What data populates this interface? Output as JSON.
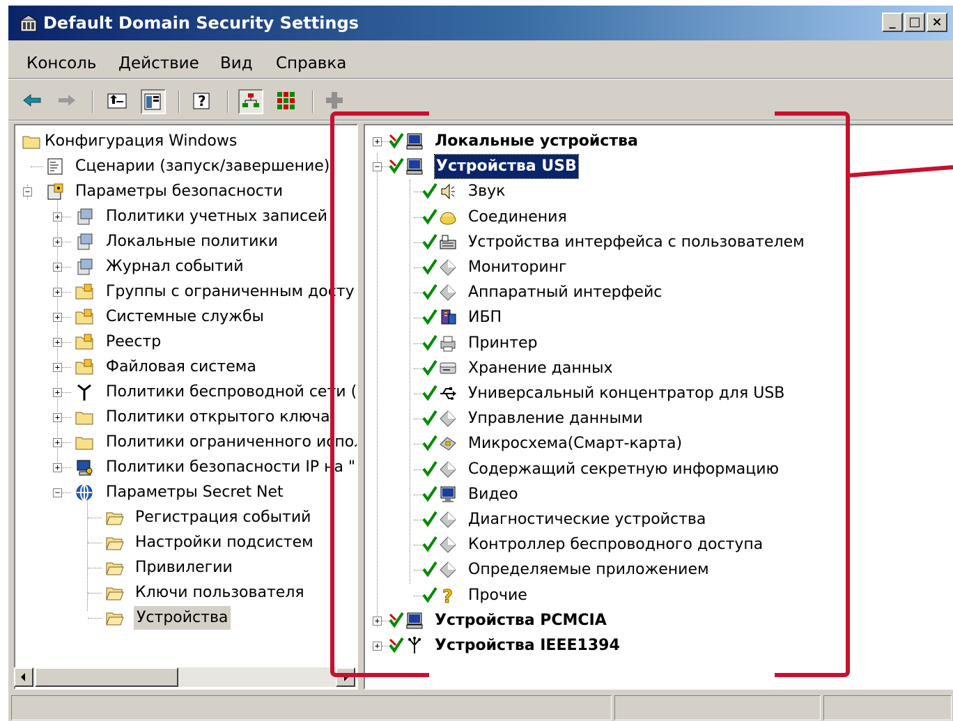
{
  "window": {
    "title": "Default Domain Security Settings",
    "controls": {
      "minimize": "_",
      "maximize": "□",
      "close": "×"
    }
  },
  "menu": [
    {
      "label": "Консоль"
    },
    {
      "label": "Действие"
    },
    {
      "label": "Вид"
    },
    {
      "label": "Справка"
    }
  ],
  "toolbar": {
    "buttons": [
      "back-arrow-icon",
      "forward-arrow-icon",
      "up-folder-icon",
      "show-hide-tree-icon",
      "help-icon",
      "tree-view-icon",
      "grid-view-icon",
      "add-icon"
    ]
  },
  "left_tree": [
    {
      "label": "Конфигурация Windows",
      "icon": "folder-icon"
    },
    {
      "label": "Сценарии (запуск/завершение)",
      "icon": "script-icon"
    },
    {
      "label": "Параметры безопасности",
      "icon": "security-icon",
      "expanded": true
    },
    {
      "label": "Политики учетных записей",
      "icon": "policy-icon"
    },
    {
      "label": "Локальные политики",
      "icon": "policy-icon"
    },
    {
      "label": "Журнал событий",
      "icon": "policy-icon"
    },
    {
      "label": "Группы с ограниченным досту",
      "icon": "locked-folder-icon"
    },
    {
      "label": "Системные службы",
      "icon": "locked-folder-icon"
    },
    {
      "label": "Реестр",
      "icon": "locked-folder-icon"
    },
    {
      "label": "Файловая система",
      "icon": "locked-folder-icon"
    },
    {
      "label": "Политики беспроводной сети (",
      "icon": "antenna-icon"
    },
    {
      "label": "Политики открытого ключа",
      "icon": "folder-icon"
    },
    {
      "label": "Политики ограниченного испол",
      "icon": "folder-icon"
    },
    {
      "label": "Политики безопасности IP на \"",
      "icon": "ip-security-icon"
    },
    {
      "label": "Параметры Secret Net",
      "icon": "secret-net-icon",
      "expanded": true
    },
    {
      "label": "Регистрация событий",
      "icon": "open-folder-icon"
    },
    {
      "label": "Настройки подсистем",
      "icon": "open-folder-icon"
    },
    {
      "label": "Привилегии",
      "icon": "open-folder-icon"
    },
    {
      "label": "Ключи пользователя",
      "icon": "open-folder-icon"
    },
    {
      "label": "Устройства",
      "icon": "open-folder-icon",
      "selected": true
    }
  ],
  "right_tree": [
    {
      "label": "Локальные устройства",
      "icon": "computer-icon",
      "level": 0,
      "expander": "+"
    },
    {
      "label": "Устройства USB",
      "icon": "computer-icon",
      "level": 0,
      "expander": "-",
      "selected": true
    },
    {
      "label": "Звук",
      "icon": "speaker-icon",
      "level": 1
    },
    {
      "label": "Соединения",
      "icon": "modem-icon",
      "level": 1
    },
    {
      "label": "Устройства интерфейса с пользователем",
      "icon": "keyboard-icon",
      "level": 1
    },
    {
      "label": "Мониторинг",
      "icon": "diamond-icon",
      "level": 1
    },
    {
      "label": "Аппаратный интерфейс",
      "icon": "diamond-icon",
      "level": 1
    },
    {
      "label": "ИБП",
      "icon": "ups-icon",
      "level": 1
    },
    {
      "label": "Принтер",
      "icon": "printer-icon",
      "level": 1
    },
    {
      "label": "Хранение данных",
      "icon": "drive-icon",
      "level": 1
    },
    {
      "label": "Универсальный концентратор для USB",
      "icon": "usb-icon",
      "level": 1
    },
    {
      "label": "Управление данными",
      "icon": "diamond-icon",
      "level": 1
    },
    {
      "label": "Микросхема(Смарт-карта)",
      "icon": "smartcard-icon",
      "level": 1
    },
    {
      "label": "Содержащий секретную информацию",
      "icon": "diamond-icon",
      "level": 1
    },
    {
      "label": "Видео",
      "icon": "monitor-icon",
      "level": 1
    },
    {
      "label": "Диагностические устройства",
      "icon": "diamond-icon",
      "level": 1
    },
    {
      "label": "Контроллер беспроводного доступа",
      "icon": "diamond-icon",
      "level": 1
    },
    {
      "label": "Определяемые приложением",
      "icon": "diamond-icon",
      "level": 1
    },
    {
      "label": "Прочие",
      "icon": "question-icon",
      "level": 1
    },
    {
      "label": "Устройства PCMCIA",
      "icon": "computer-icon",
      "level": 0,
      "expander": "+"
    },
    {
      "label": "Устройства IEEE1394",
      "icon": "firewire-icon",
      "level": 0,
      "expander": "+"
    }
  ],
  "colors": {
    "title_start": "#0a246a",
    "title_end": "#a6caf0",
    "selection": "#0a246a",
    "check_green": "#008a00",
    "check_red": "#d40000",
    "annotation_bracket": "#c8102e"
  }
}
